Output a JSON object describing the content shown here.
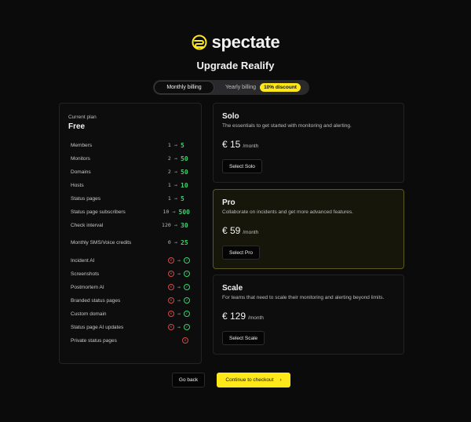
{
  "brand": {
    "name": "spectate",
    "accent": "#ffe81a",
    "icon": "spectate-logo-icon"
  },
  "title": "Upgrade Realify",
  "billing": {
    "monthly_label": "Monthly billing",
    "yearly_label": "Yearly billing",
    "discount": "10% discount",
    "selected": "Monthly billing"
  },
  "current_plan": {
    "label": "Current plan",
    "name": "Free",
    "quotas": [
      {
        "label": "Members",
        "from": "1",
        "to": "5"
      },
      {
        "label": "Monitors",
        "from": "2",
        "to": "50"
      },
      {
        "label": "Domains",
        "from": "2",
        "to": "50"
      },
      {
        "label": "Hosts",
        "from": "1",
        "to": "10"
      },
      {
        "label": "Status pages",
        "from": "1",
        "to": "5"
      },
      {
        "label": "Status page subscribers",
        "from": "10",
        "to": "500"
      },
      {
        "label": "Check interval",
        "from": "120",
        "to": "30"
      },
      {
        "label": "Monthly SMS/Voice credits",
        "from": "0",
        "to": "25"
      }
    ],
    "features": [
      {
        "label": "Incident AI",
        "current": "x-icon",
        "upgraded": "check-icon"
      },
      {
        "label": "Screenshots",
        "current": "x-icon",
        "upgraded": "check-icon"
      },
      {
        "label": "Postmortem AI",
        "current": "x-icon",
        "upgraded": "check-icon"
      },
      {
        "label": "Branded status pages",
        "current": "x-icon",
        "upgraded": "check-icon"
      },
      {
        "label": "Custom domain",
        "current": "x-icon",
        "upgraded": "check-icon"
      },
      {
        "label": "Status page AI updates",
        "current": "x-icon",
        "upgraded": "check-icon"
      },
      {
        "label": "Private status pages",
        "current": "x-icon",
        "upgraded": ""
      }
    ],
    "arrow": "→"
  },
  "tiers": [
    {
      "name": "Solo",
      "description": "The essentials to get started with monitoring and alerting.",
      "price": "€ 15",
      "period": "/month",
      "button": "Select Solo",
      "highlighted": false
    },
    {
      "name": "Pro",
      "description": "Collaborate on incidents and get more advanced features.",
      "price": "€ 59",
      "period": "/month",
      "button": "Select Pro",
      "highlighted": true
    },
    {
      "name": "Scale",
      "description": "For teams that need to scale their monitoring and alerting beyond limits.",
      "price": "€ 129",
      "period": "/month",
      "button": "Select Scale",
      "highlighted": false
    }
  ],
  "actions": {
    "back": "Go back",
    "checkout": "Continue to checkout",
    "checkout_icon": "chevron-right-icon"
  },
  "colors": {
    "background": "#0b0b0c",
    "accent": "#ffe81a",
    "success": "#3ecf6e",
    "danger": "#e05555"
  }
}
